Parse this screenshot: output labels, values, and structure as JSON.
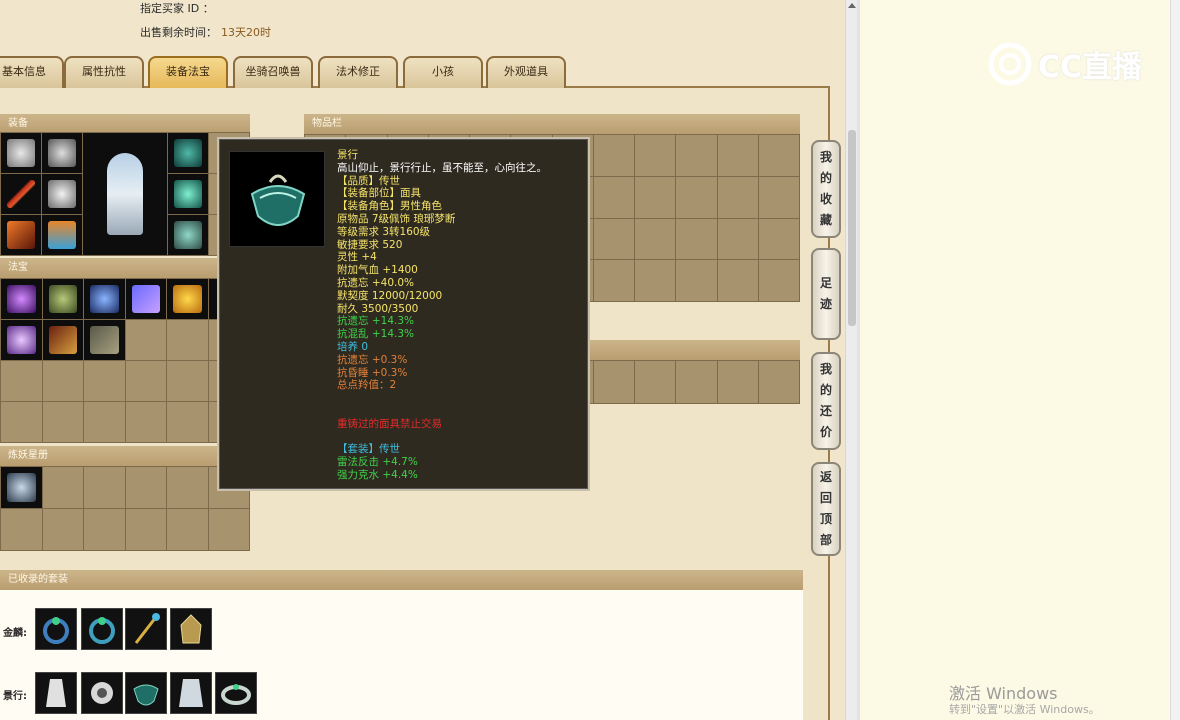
{
  "header": {
    "buyer_label": "指定买家 ID ：",
    "remaining_label": "出售剩余时间：",
    "remaining_value": "13天20时"
  },
  "tabs": [
    {
      "label": "基本信息",
      "active": false
    },
    {
      "label": "属性抗性",
      "active": false
    },
    {
      "label": "装备法宝",
      "active": true
    },
    {
      "label": "坐骑召唤兽",
      "active": false
    },
    {
      "label": "法术修正",
      "active": false
    },
    {
      "label": "小孩",
      "active": false
    },
    {
      "label": "外观道具",
      "active": false
    }
  ],
  "sections": {
    "equipment": "装备",
    "treasure": "法宝",
    "astral": "炼妖星册",
    "inventory": "物品栏",
    "collected": "已收录的套装"
  },
  "tooltip": {
    "lines": [
      {
        "text": "景行",
        "color": "#f5e36a"
      },
      {
        "text": "高山仰止，景行行止，虽不能至，心向往之。",
        "color": "#ffffff"
      },
      {
        "text": "【品质】传世",
        "color": "#f5e36a"
      },
      {
        "text": "【装备部位】面具",
        "color": "#f5e36a"
      },
      {
        "text": "【装备角色】男性角色",
        "color": "#f5e36a"
      },
      {
        "text": "原物品 7级佩饰 琅琊梦断",
        "color": "#f5e36a"
      },
      {
        "text": "等级需求 3转160级",
        "color": "#f5e36a"
      },
      {
        "text": "敏捷要求 520",
        "color": "#f5e36a"
      },
      {
        "text": "灵性 +4",
        "color": "#f5e36a"
      },
      {
        "text": "附加气血 +1400",
        "color": "#f5e36a"
      },
      {
        "text": "抗遗忘 +40.0%",
        "color": "#f5e36a"
      },
      {
        "text": "默契度 12000/12000",
        "color": "#f5e36a"
      },
      {
        "text": "耐久 3500/3500",
        "color": "#f5e36a"
      },
      {
        "text": "抗遗忘 +14.3%",
        "color": "#3fd24a"
      },
      {
        "text": "抗混乱 +14.3%",
        "color": "#3fd24a"
      },
      {
        "text": "培养 0",
        "color": "#3fbfe0"
      },
      {
        "text": "抗遗忘 +0.3%",
        "color": "#e0813a"
      },
      {
        "text": "抗昏睡 +0.3%",
        "color": "#e0813a"
      },
      {
        "text": "总点羚值：2",
        "color": "#e0813a"
      },
      {
        "text": "",
        "color": "#ffffff"
      },
      {
        "text": "",
        "color": "#ffffff"
      },
      {
        "text": "重铸过的面具禁止交易",
        "color": "#e52a2a"
      },
      {
        "text": "",
        "color": "#ffffff"
      },
      {
        "text": "【套装】传世",
        "color": "#3fbfe0"
      },
      {
        "text": "雷法反击 +4.7%",
        "color": "#3fd24a"
      },
      {
        "text": "强力克水 +4.4%",
        "color": "#3fd24a"
      }
    ]
  },
  "side_buttons": [
    {
      "label": "我的收藏",
      "chars": [
        "我",
        "的",
        "收",
        "藏"
      ]
    },
    {
      "label": "足迹",
      "chars": [
        "足",
        "迹"
      ]
    },
    {
      "label": "我的还价",
      "chars": [
        "我",
        "的",
        "还",
        "价"
      ]
    },
    {
      "label": "返回顶部",
      "chars": [
        "返",
        "回",
        "顶",
        "部"
      ]
    }
  ],
  "collected_sets": [
    {
      "label": "金麟:",
      "items": 4
    },
    {
      "label": "景行:",
      "items": 5
    }
  ],
  "watermarks": {
    "cc": "CC直播",
    "windows_title": "激活 Windows",
    "windows_sub": "转到\"设置\"以激活 Windows。"
  },
  "colors": {
    "accent": "#e6b85a",
    "frame": "#9b7b48",
    "grid_bg": "#a7936e"
  }
}
